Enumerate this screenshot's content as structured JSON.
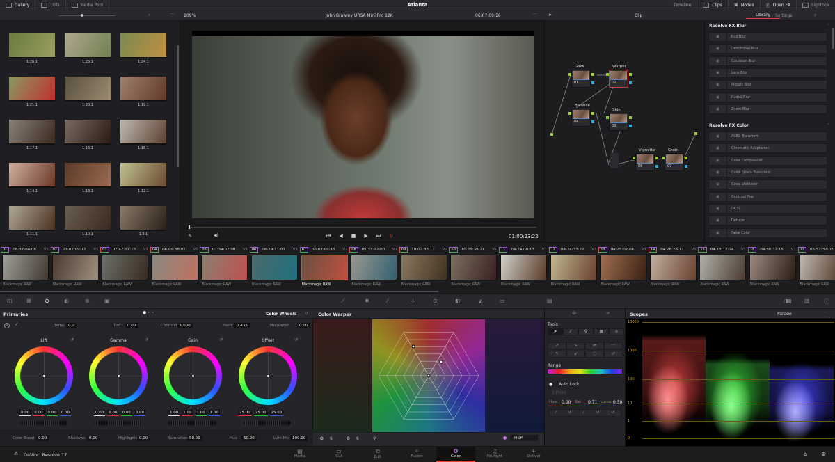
{
  "topbar": {
    "tabs": [
      "Gallery",
      "LUTs",
      "Media Pool"
    ],
    "project": "Atlanta",
    "right": [
      "Timeline",
      "Clips",
      "Nodes",
      "Open FX",
      "Lightbox"
    ]
  },
  "gallery": {
    "stills": [
      "1.26.1",
      "1.25.1",
      "1.24.1",
      "1.21.1",
      "1.20.1",
      "1.19.1",
      "1.17.1",
      "1.16.1",
      "1.15.1",
      "1.14.1",
      "1.13.1",
      "1.12.1",
      "1.11.1",
      "1.10.1",
      "1.9.1"
    ]
  },
  "viewer": {
    "zoom": "109%",
    "clip_name": "John Brawley URSA Mini Pro 12K",
    "timecode": "06:07:09:16",
    "record_timecode": "01:00:23:22"
  },
  "nodes": {
    "mode": "Clip",
    "items": [
      {
        "label": "Glow",
        "num": "01"
      },
      {
        "label": "Warper",
        "num": "02"
      },
      {
        "label": "Balance",
        "num": "04"
      },
      {
        "label": "Skin",
        "num": "03"
      },
      {
        "label": "Vignette",
        "num": "06"
      },
      {
        "label": "Grain",
        "num": "07"
      }
    ]
  },
  "library": {
    "tabs": [
      "Library",
      "Settings"
    ],
    "sections": [
      {
        "title": "Resolve FX Blur",
        "items": [
          "Box Blur",
          "Directional Blur",
          "Gaussian Blur",
          "Lens Blur",
          "Mosaic Blur",
          "Radial Blur",
          "Zoom Blur"
        ]
      },
      {
        "title": "Resolve FX Color",
        "items": [
          "ACES Transform",
          "Chromatic Adaptation",
          "Color Compressor",
          "Color Space Transform",
          "Color Stabilizer",
          "Contrast Pop",
          "DCTL",
          "Dehaze",
          "False Color"
        ]
      }
    ]
  },
  "clips": [
    {
      "num": "01",
      "tc": "06:37:04:08"
    },
    {
      "num": "02",
      "tc": "07:02:09:12"
    },
    {
      "num": "03",
      "tc": "07:47:11:13"
    },
    {
      "num": "04",
      "tc": "06:09:38:01"
    },
    {
      "num": "05",
      "tc": "07:34:07:08"
    },
    {
      "num": "06",
      "tc": "06:29:11:01"
    },
    {
      "num": "07",
      "tc": "06:07:09:16"
    },
    {
      "num": "08",
      "tc": "05:33:22:00"
    },
    {
      "num": "09",
      "tc": "10:02:33:17"
    },
    {
      "num": "10",
      "tc": "10:25:39:21"
    },
    {
      "num": "11",
      "tc": "04:24:00:13"
    },
    {
      "num": "12",
      "tc": "04:24:33:22"
    },
    {
      "num": "13",
      "tc": "04:25:02:06"
    },
    {
      "num": "14",
      "tc": "04:26:28:11"
    },
    {
      "num": "15",
      "tc": "04:13:12:14"
    },
    {
      "num": "16",
      "tc": "04:56:32:15"
    },
    {
      "num": "17",
      "tc": "05:52:37:07"
    }
  ],
  "clip_track": "V1",
  "clip_codec": "Blackmagic RAW",
  "selected_clip": "07",
  "primaries": {
    "title": "Primaries",
    "mode": "Color Wheels",
    "top": [
      {
        "label": "Temp",
        "value": "0.0"
      },
      {
        "label": "Tint",
        "value": "0.00"
      },
      {
        "label": "Contrast",
        "value": "1.000"
      },
      {
        "label": "Pivot",
        "value": "0.435"
      },
      {
        "label": "Mid/Detail",
        "value": "0.00"
      }
    ],
    "wheels": [
      {
        "name": "Lift",
        "values": [
          "0.00",
          "0.00",
          "0.00",
          "0.00"
        ]
      },
      {
        "name": "Gamma",
        "values": [
          "0.00",
          "0.00",
          "0.00",
          "0.00"
        ]
      },
      {
        "name": "Gain",
        "values": [
          "1.00",
          "1.00",
          "1.00",
          "1.00"
        ]
      },
      {
        "name": "Offset",
        "values": [
          "25.00",
          "25.00",
          "25.00"
        ]
      }
    ],
    "bottom": [
      {
        "label": "Color Boost",
        "value": "0.00"
      },
      {
        "label": "Shadows",
        "value": "0.00"
      },
      {
        "label": "Highlights",
        "value": "0.00"
      },
      {
        "label": "Saturation",
        "value": "50.00"
      },
      {
        "label": "Hue",
        "value": "50.00"
      },
      {
        "label": "Lum Mix",
        "value": "100.00"
      }
    ]
  },
  "warper": {
    "title": "Color Warper",
    "grid1": "6",
    "grid2": "6",
    "space": "HSP"
  },
  "tools": {
    "title": "Tools",
    "range": "Range",
    "auto_lock": "Auto Lock",
    "points": "1 Point",
    "hue_label": "Hue",
    "hue": "0.00",
    "sat_label": "Sat",
    "sat": "0.71",
    "luma_label": "Luma",
    "luma": "0.50"
  },
  "scopes": {
    "title": "Scopes",
    "mode": "Parade",
    "scale": [
      "10000",
      "1000",
      "100",
      "10",
      "1",
      "0"
    ]
  },
  "footer": {
    "app": "DaVinci Resolve 17",
    "pages": [
      "Media",
      "Cut",
      "Edit",
      "Fusion",
      "Color",
      "Fairlight",
      "Deliver"
    ],
    "active_page": "Color"
  }
}
